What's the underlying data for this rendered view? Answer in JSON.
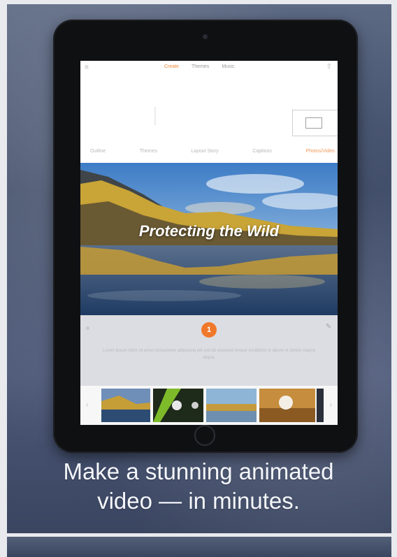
{
  "screen": {
    "tabs": [
      {
        "label": "Create",
        "active": true
      },
      {
        "label": "Themes",
        "active": false
      },
      {
        "label": "Music",
        "active": false
      }
    ],
    "nav": [
      {
        "label": "Outline",
        "active": false
      },
      {
        "label": "Themes",
        "active": false
      },
      {
        "label": "Layout Story",
        "active": false
      },
      {
        "label": "Captions",
        "active": false
      },
      {
        "label": "Photos/Video",
        "active": true
      }
    ],
    "hero_title": "Protecting the Wild",
    "step_number": "1",
    "caption_text": "Lorem ipsum dolor sit amet consectetur adipiscing elit sed do eiusmod tempor incididunt ut labore et dolore magna aliqua."
  },
  "tagline_line1": "Make a stunning animated",
  "tagline_line2": "video — in minutes.",
  "colors": {
    "accent": "#f0782a",
    "background": "#3d4a66"
  }
}
